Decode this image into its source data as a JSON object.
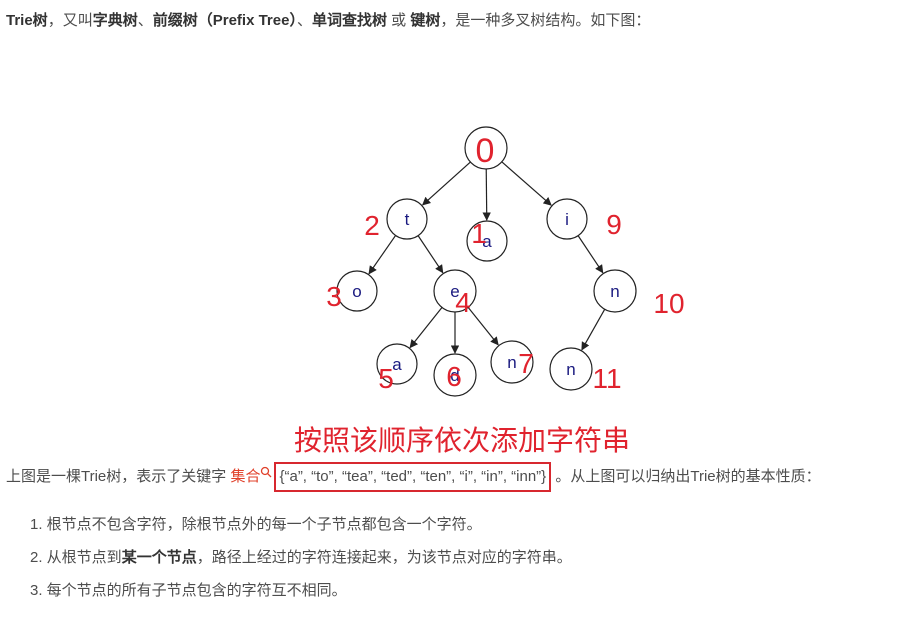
{
  "intro": {
    "term": "Trie树",
    "sep1": "，又叫",
    "name1": "字典树",
    "sep2": "、",
    "name2": "前缀树（Prefix Tree）",
    "sep3": "、",
    "name3": "单词查找树",
    "sep4": " 或 ",
    "name4": "键树",
    "tail": "，是一种多叉树结构。如下图："
  },
  "diagram": {
    "root_label": "0",
    "nodes": [
      {
        "char": "",
        "num": "0"
      },
      {
        "char": "t",
        "num": "2"
      },
      {
        "char": "a",
        "num": "1"
      },
      {
        "char": "i",
        "num": "9"
      },
      {
        "char": "o",
        "num": "3"
      },
      {
        "char": "e",
        "num": "4"
      },
      {
        "char": "n",
        "num": "10"
      },
      {
        "char": "a",
        "num": "5"
      },
      {
        "char": "d",
        "num": "6"
      },
      {
        "char": "n",
        "num": "7"
      },
      {
        "char": "n",
        "num": "11"
      }
    ],
    "annotation": "按照该顺序依次添加字符串"
  },
  "caption": {
    "before": "上图是一棵Trie树，表示了关键字 ",
    "link": "集合",
    "set_text": "{“a”, “to”, “tea”, “ted”, “ten”, “i”, “in”, “inn”}",
    "after": " 。从上图可以归纳出Trie树的基本性质："
  },
  "properties": [
    {
      "pre": "1. 根节点不包含字符，除根节点外的每一个子节点都包含一个字符。",
      "bold": "",
      "post": ""
    },
    {
      "pre": "2. 从根节点到",
      "bold": "某一个节点",
      "post": "，路径上经过的字符连接起来，为该节点对应的字符串。"
    },
    {
      "pre": "3. 每个节点的所有子节点包含的字符互不相同。",
      "bold": "",
      "post": ""
    }
  ],
  "colors": {
    "edge": "#222222",
    "node_char": "#1a1a80",
    "red_number": "#e0232e",
    "link": "#e0402a"
  }
}
